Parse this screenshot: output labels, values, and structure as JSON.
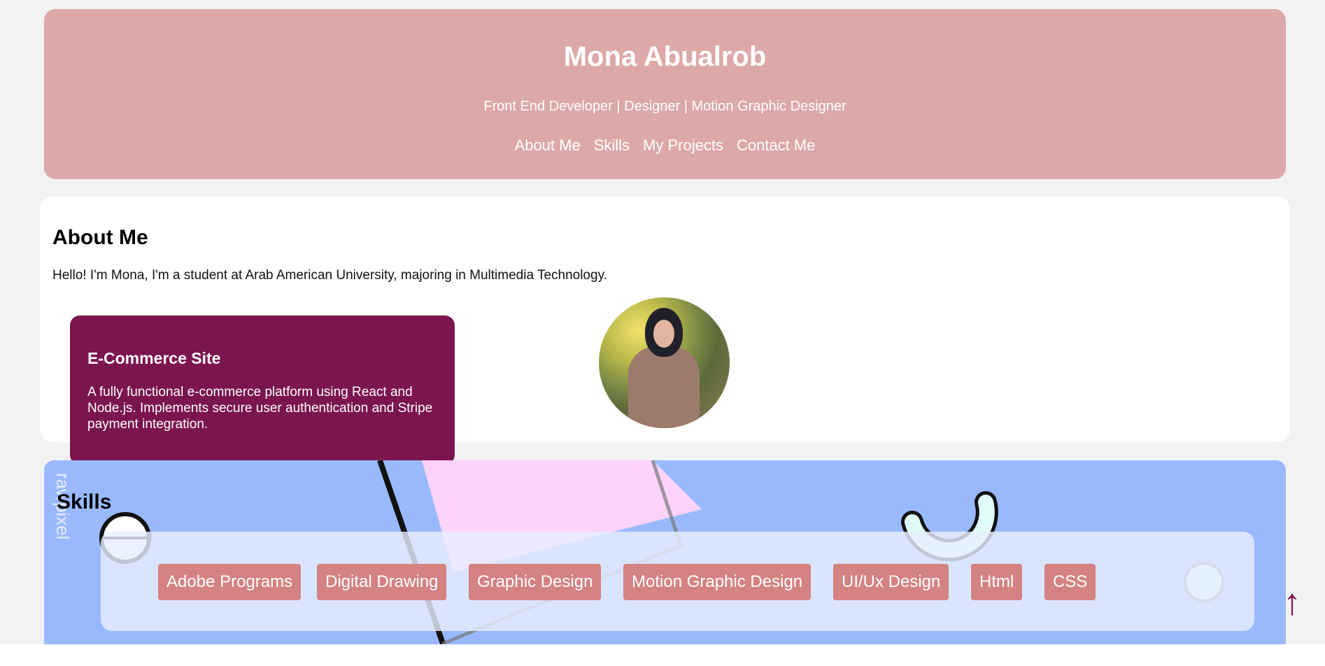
{
  "header": {
    "name": "Mona Abualrob",
    "tagline": "Front End Developer | Designer | Motion Graphic Designer",
    "nav": [
      "About Me",
      "Skills",
      "My Projects",
      "Contact Me"
    ]
  },
  "about": {
    "heading": "About Me",
    "text": "Hello! I'm Mona, I'm a student at Arab American University, majoring in Multimedia Technology."
  },
  "project": {
    "title": "E-Commerce Site",
    "description": "A fully functional e-commerce platform using React and Node.js. Implements secure user authentication and Stripe payment integration."
  },
  "skills": {
    "heading": "Skills",
    "watermark": "rawpixel",
    "items": [
      "Adobe Programs",
      "Digital Drawing",
      "Graphic Design",
      "Motion Graphic Design",
      "UI/Ux Design",
      "Html",
      "CSS"
    ]
  },
  "scroll_top": "↑",
  "colors": {
    "header_bg": "#dca8a8",
    "card_bg": "#7b154e",
    "skills_bg": "#99b9ff",
    "chip_bg": "#d48282"
  }
}
